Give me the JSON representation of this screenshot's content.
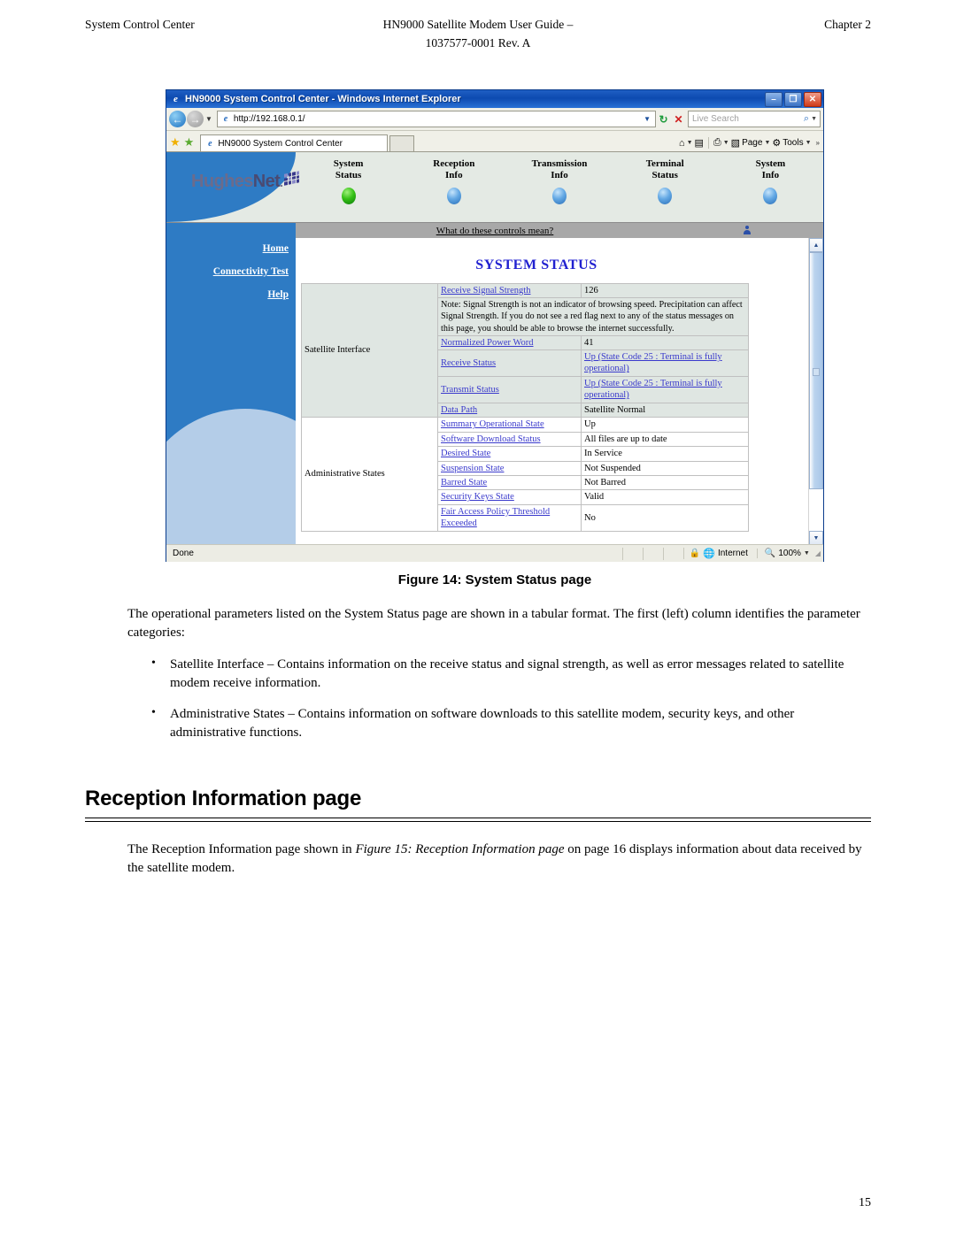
{
  "header": {
    "left": "System Control Center",
    "center_line1": "HN9000 Satellite Modem User Guide –",
    "center_line2": "1037577-0001 Rev. A",
    "right": "Chapter 2"
  },
  "browser": {
    "title": "HN9000 System Control Center - Windows Internet Explorer",
    "minimize_label": "–",
    "restore_label": "❐",
    "close_label": "✕",
    "back_label": "←",
    "forward_label": "→",
    "nav_dropdown_label": "▼",
    "url": "http://192.168.0.1/",
    "url_dropdown_label": "▼",
    "refresh_label": "↻",
    "stop_label": "✕",
    "search_placeholder": "Live Search",
    "search_go_label": "⌕",
    "search_dropdown_label": "▼",
    "favorites_star_label": "★",
    "add_favorites_label": "★",
    "tab_label": "HN9000 System Control Center",
    "commands": [
      {
        "icon": "⌂",
        "label": "",
        "arrow": "▼",
        "name": "home"
      },
      {
        "icon": "▤",
        "label": "",
        "arrow": "",
        "name": "feeds"
      },
      {
        "icon": "⎙",
        "label": "",
        "arrow": "▼",
        "name": "print"
      },
      {
        "icon": "▧",
        "label": "Page",
        "arrow": "▼",
        "name": "page"
      },
      {
        "icon": "⚙",
        "label": "Tools",
        "arrow": "▼",
        "name": "tools"
      }
    ],
    "overflow_label": "»",
    "status_done": "Done",
    "status_zone": "Internet",
    "status_zoom": "100%",
    "status_zoom_arrow": "▼"
  },
  "webapp": {
    "logo": {
      "hughes": "Hughes",
      "net": "Net",
      "dot": "."
    },
    "nav": [
      {
        "line1": "System",
        "line2": "Status",
        "led": "green"
      },
      {
        "line1": "Reception",
        "line2": "Info",
        "led": "blue"
      },
      {
        "line1": "Transmission",
        "line2": "Info",
        "led": "blue"
      },
      {
        "line1": "Terminal",
        "line2": "Status",
        "led": "blue"
      },
      {
        "line1": "System",
        "line2": "Info",
        "led": "blue"
      }
    ],
    "controls_link": "What do these controls mean?",
    "sidebar": [
      {
        "label": "Home"
      },
      {
        "label": "Connectivity Test"
      },
      {
        "label": "Help"
      }
    ],
    "page_title": "SYSTEM STATUS",
    "categories": {
      "satellite": "Satellite Interface",
      "administrative": "Administrative States"
    },
    "satellite_rows": [
      {
        "param": "Receive Signal Strength",
        "value": "126",
        "param_link": true,
        "value_link": false
      },
      {
        "param": "Normalized Power Word",
        "value": "41",
        "param_link": true,
        "value_link": false
      },
      {
        "param": "Receive Status",
        "value": "Up (State Code 25 : Terminal is fully operational)",
        "param_link": true,
        "value_link": true
      },
      {
        "param": "Transmit Status",
        "value": "Up (State Code 25 : Terminal is fully operational)",
        "param_link": true,
        "value_link": true
      },
      {
        "param": "Data Path",
        "value": "Satellite Normal",
        "param_link": true,
        "value_link": false
      }
    ],
    "note": "Note: Signal Strength is not an indicator of browsing speed. Precipitation can affect Signal Strength. If you do not see a red flag next to any of the status messages on this page, you should be able to browse the internet successfully.",
    "administrative_rows": [
      {
        "param": "Summary Operational State",
        "value": "Up"
      },
      {
        "param": "Software Download Status",
        "value": "All files are up to date"
      },
      {
        "param": "Desired State",
        "value": "In Service"
      },
      {
        "param": "Suspension State",
        "value": "Not Suspended"
      },
      {
        "param": "Barred State",
        "value": "Not Barred"
      },
      {
        "param": "Security Keys State",
        "value": "Valid"
      },
      {
        "param": "Fair Access Policy Threshold Exceeded",
        "value": "No"
      }
    ]
  },
  "figure": {
    "caption": "Figure 14: System Status page"
  },
  "document": {
    "intro": "The operational parameters listed on the System Status page are shown in a tabular format. The first (left) column identifies the parameter categories:",
    "bullets": [
      "Satellite Interface – Contains information on the receive status and signal strength, as well as error messages related to satellite modem receive information.",
      "Administrative States – Contains information on software downloads to this satellite modem, security keys, and other administrative functions."
    ],
    "section_heading": "Reception Information page",
    "closing_part1": "The Reception Information page shown in ",
    "closing_italic": "Figure 15: Reception Information page",
    "closing_part2": " on page 16 displays information about data received by the satellite modem."
  },
  "page_number": "15"
}
